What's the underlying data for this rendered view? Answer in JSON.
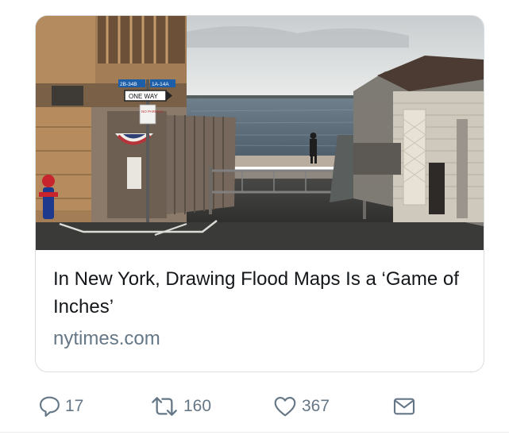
{
  "card": {
    "title": "In New York, Drawing Flood Maps Is a ‘Game of Inches’",
    "domain": "nytimes.com",
    "image": {
      "street_signs": [
        "2B-34B",
        "1A-14A"
      ],
      "one_way_sign": "ONE WAY",
      "parking_sign": "NO PARKING"
    }
  },
  "actions": {
    "reply_count": "17",
    "retweet_count": "160",
    "like_count": "367"
  },
  "colors": {
    "text_primary": "#14171a",
    "text_secondary": "#657786",
    "border": "#d9dee2"
  },
  "icons": [
    "reply-icon",
    "retweet-icon",
    "like-icon",
    "direct-message-icon"
  ]
}
